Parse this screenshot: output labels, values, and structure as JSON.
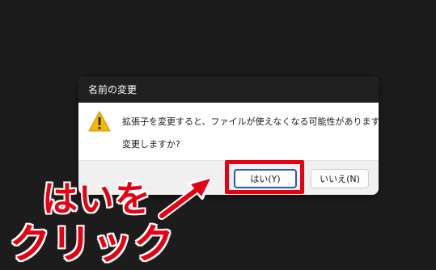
{
  "dialog": {
    "title": "名前の変更",
    "message": "拡張子を変更すると、ファイルが使えなくなる可能性があります。",
    "question": "変更しますか?",
    "yes_button": "はい(Y)",
    "no_button": "いいえ(N)",
    "icon": "warning-icon"
  },
  "annotation": {
    "line1": "はいを",
    "line2": "クリック",
    "color": "#e60012"
  },
  "colors": {
    "background": "#1c1c1c",
    "titlebar": "#202020",
    "accent": "#1f5fad",
    "highlight": "#e60012"
  }
}
